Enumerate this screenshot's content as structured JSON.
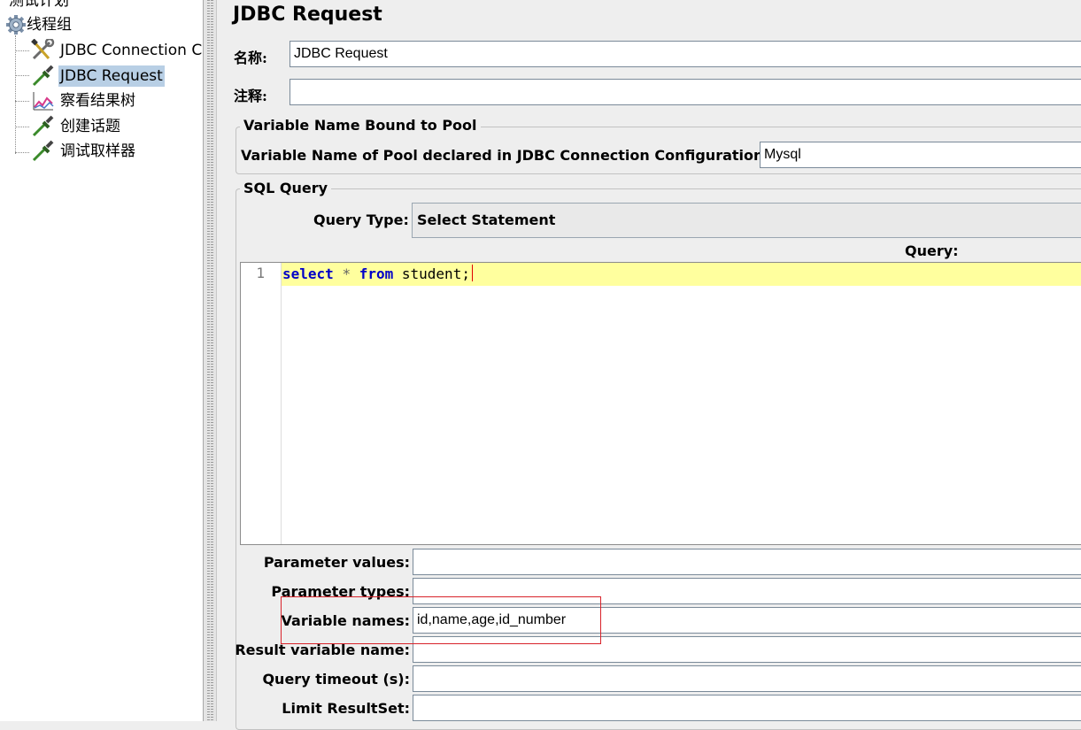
{
  "tree": {
    "top_partial": "测试计划",
    "thread_group": "线程组",
    "items": [
      {
        "label": "JDBC Connection C",
        "icon": "wrench-screwdriver-icon"
      },
      {
        "label": "JDBC Request",
        "icon": "dropper-sampler-icon",
        "selected": true
      },
      {
        "label": "察看结果树",
        "icon": "chart-listener-icon"
      },
      {
        "label": "创建话题",
        "icon": "dropper-sampler-icon"
      },
      {
        "label": "调试取样器",
        "icon": "dropper-sampler-icon"
      }
    ]
  },
  "panel": {
    "title": "JDBC Request",
    "name_label": "名称:",
    "name_value": "JDBC Request",
    "comment_label": "注释:",
    "comment_value": "",
    "pool_group_title": "Variable Name Bound to Pool",
    "pool_label": "Variable Name of Pool declared in JDBC Connection Configuration:",
    "pool_value": "Mysql",
    "sql_group_title": "SQL Query",
    "query_type_label": "Query Type:",
    "query_type_value": "Select Statement",
    "query_label": "Query:",
    "editor": {
      "line_number": "1",
      "kw_select": "select",
      "op_star": "*",
      "kw_from": "from",
      "rest": "student;"
    },
    "params": [
      {
        "label": "Parameter values:",
        "value": ""
      },
      {
        "label": "Parameter types:",
        "value": ""
      },
      {
        "label": "Variable names:",
        "value": "id,name,age,id_number"
      },
      {
        "label": "Result variable name:",
        "value": ""
      },
      {
        "label": "Query timeout (s):",
        "value": ""
      },
      {
        "label": "Limit ResultSet:",
        "value": ""
      }
    ]
  },
  "colors": {
    "selection": "#b8cfe5",
    "highlight_box": "#d8232a",
    "keyword": "#0000c8",
    "current_line": "#ffff9e"
  }
}
